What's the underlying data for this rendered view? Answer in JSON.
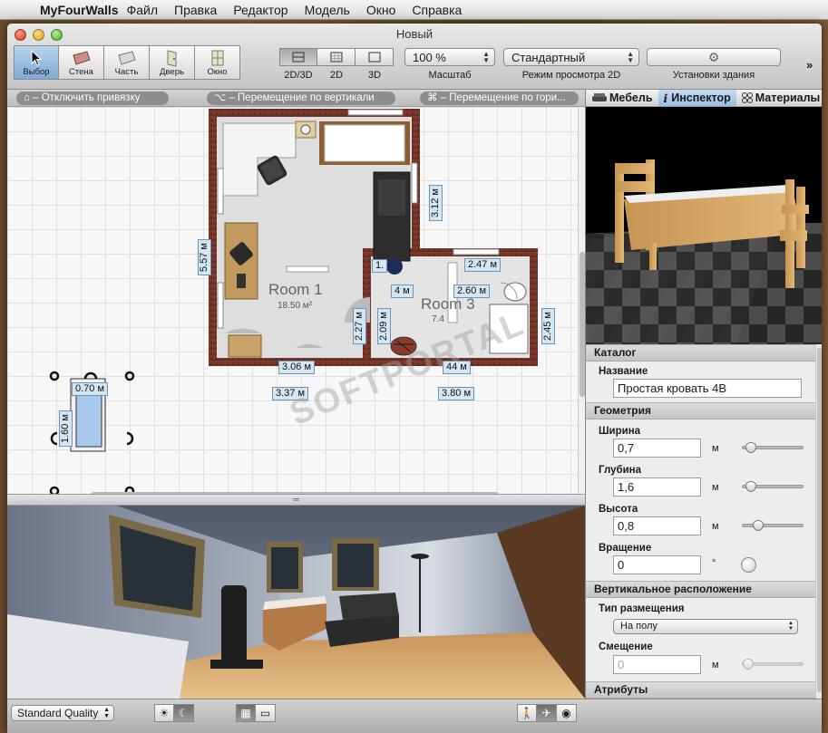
{
  "menubar": {
    "app_name": "MyFourWalls",
    "items": [
      "Файл",
      "Правка",
      "Редактор",
      "Модель",
      "Окно",
      "Справка"
    ]
  },
  "window": {
    "title": "Новый"
  },
  "toolbar": {
    "tools": [
      {
        "label": "Выбор",
        "icon": "cursor-icon",
        "active": true
      },
      {
        "label": "Стена",
        "icon": "wall-icon",
        "active": false
      },
      {
        "label": "Часть",
        "icon": "part-icon",
        "active": false
      },
      {
        "label": "Дверь",
        "icon": "door-icon",
        "active": false
      },
      {
        "label": "Окно",
        "icon": "window-icon",
        "active": false
      }
    ],
    "view_modes": [
      "2D/3D",
      "2D",
      "3D"
    ],
    "active_view_mode": "2D/3D",
    "zoom": {
      "value": "100 %",
      "label": "Масштаб"
    },
    "view_mode_2d": {
      "value": "Стандартный",
      "label": "Режим просмотра 2D"
    },
    "building_settings_label": "Установки здания",
    "overflow": "»"
  },
  "hints": {
    "snap": "⌂ – Отключить привязку",
    "vertical": "⌥ – Перемещение по вертикали",
    "horizontal": "⌘ – Перемещение по гори..."
  },
  "plan": {
    "rooms": [
      {
        "name": "Room 1",
        "area": "18.50 м²"
      },
      {
        "name": "Room 3",
        "area": "7.4"
      }
    ],
    "dimensions": {
      "d312": "3.12 м",
      "d557": "5.57 м",
      "d247": "2.47 м",
      "d260": "2.60 м",
      "d1x": "1.",
      "d4": "4 м",
      "d227": "2.27 м",
      "d209": "2.09 м",
      "d245": "2.45 м",
      "d306": "3.06 м",
      "d337": "3.37 м",
      "d380": "3.80 м",
      "d44": "44 м",
      "d070": "0.70 м",
      "d160": "1.60 м"
    }
  },
  "watermark": "SOFTPORTAL",
  "bottom": {
    "quality": "Standard Quality",
    "sun_icon": "sun-icon",
    "moon_icon": "moon-icon"
  },
  "right_panel": {
    "tabs": [
      "Мебель",
      "Инспектор",
      "Материалы"
    ],
    "active_tab": "Инспектор",
    "catalog": {
      "header": "Каталог",
      "name_label": "Название",
      "name_value": "Простая кровать 4В"
    },
    "geometry": {
      "header": "Геометрия",
      "width_label": "Ширина",
      "width_value": "0,7",
      "width_unit": "м",
      "width_slider": 0.05,
      "depth_label": "Глубина",
      "depth_value": "1,6",
      "depth_unit": "м",
      "depth_slider": 0.05,
      "height_label": "Высота",
      "height_value": "0,8",
      "height_unit": "м",
      "height_slider": 0.2,
      "rotation_label": "Вращение",
      "rotation_value": "0",
      "rotation_unit": "°"
    },
    "vertical": {
      "header": "Вертикальное расположение",
      "placement_label": "Тип размещения",
      "placement_value": "На полу",
      "offset_label": "Смещение",
      "offset_value": "0",
      "offset_unit": "м"
    },
    "attributes": {
      "header": "Атрибуты"
    }
  }
}
